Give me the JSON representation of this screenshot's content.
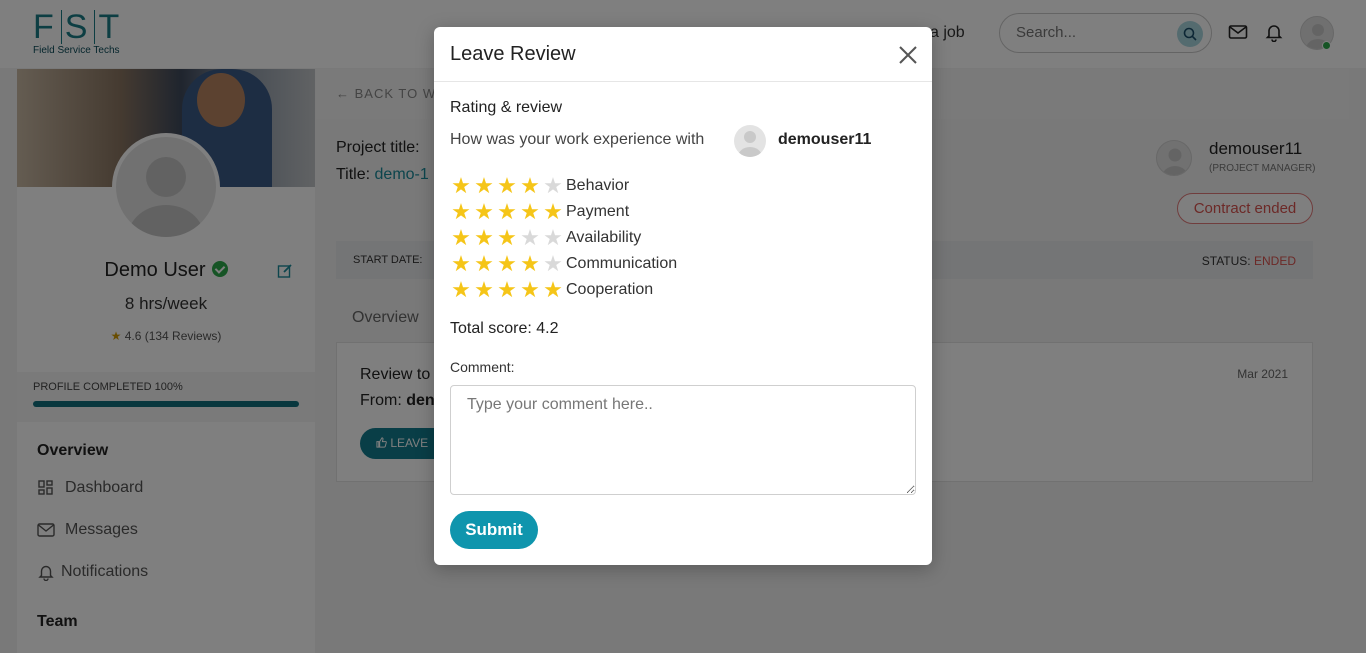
{
  "header": {
    "logo_text": "FST",
    "logo_subtitle": "Field Service Techs",
    "post_job_fragment": "a job",
    "search_placeholder": "Search..."
  },
  "sidebar": {
    "name": "Demo User",
    "hours": "8 hrs/week",
    "rating_star": "★",
    "rating": "4.6 (134 Reviews)",
    "profile_completed": "PROFILE COMPLETED 100%",
    "profile_completed_value": 1.0,
    "nav": {
      "overview_heading": "Overview",
      "items": [
        {
          "label": "Dashboard",
          "icon": "dashboard-icon"
        },
        {
          "label": "Messages",
          "icon": "mail-icon"
        },
        {
          "label": "Notifications",
          "icon": "bell-icon"
        }
      ],
      "team_heading": "Team"
    }
  },
  "main": {
    "back_link": "← BACK TO W",
    "project_title_label": "Project title:",
    "title_label": "Title:",
    "title_value": "demo-1",
    "pm_name": "demouser11",
    "pm_role": "(PROJECT MANAGER)",
    "contract_status_btn": "Contract ended",
    "start_date_label": "START DATE:",
    "status_label": "STATUS:",
    "status_value": "ENDED",
    "tab_overview": "Overview",
    "review_to": "Review to",
    "from_label": "From:",
    "from_value": "den",
    "review_date": "Mar 2021",
    "leave_btn": "LEAVE"
  },
  "modal": {
    "title": "Leave Review",
    "section_title": "Rating & review",
    "question": "How was your work experience with",
    "user": "demouser11",
    "ratings": [
      {
        "label": "Behavior",
        "stars": 4
      },
      {
        "label": "Payment",
        "stars": 5
      },
      {
        "label": "Availability",
        "stars": 3
      },
      {
        "label": "Communication",
        "stars": 4
      },
      {
        "label": "Cooperation",
        "stars": 5
      }
    ],
    "max_stars": 5,
    "total_score": "Total score: 4.2",
    "comment_label": "Comment:",
    "comment_placeholder": "Type your comment here..",
    "submit_label": "Submit"
  },
  "colors": {
    "accent": "#0f95ad",
    "brand": "#1b7d86",
    "star_on": "#f5c518",
    "star_off": "#d9d9d9",
    "status_ended": "#d9534f",
    "verified": "#2ca84a"
  }
}
